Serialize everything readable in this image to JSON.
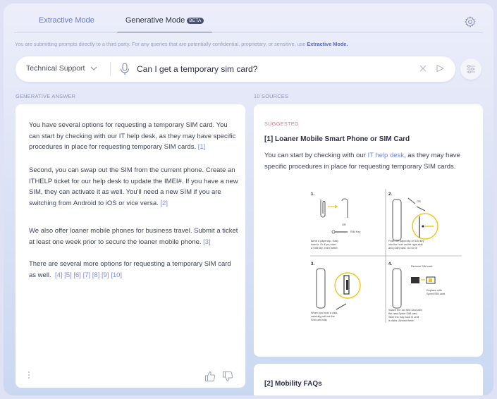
{
  "tabs": [
    {
      "label": "Extractive Mode"
    },
    {
      "label": "Generative Mode",
      "badge": "BETA"
    }
  ],
  "notice": {
    "text": "You are submitting prompts directly to a third party. For any queries that are potentially confidential, proprietary, or sensitive, use ",
    "link": "Extractive Mode."
  },
  "search": {
    "category": "Technical Support",
    "query": "Can I get a temporary sim card?"
  },
  "answer": {
    "label": "GENERATIVE ANSWER",
    "paragraphs": [
      {
        "text": "You have several options for requesting a temporary SIM card. You can start by checking with our IT help desk, as they may have specific procedures in place for requesting temporary SIM cards.",
        "cites": [
          "[1]"
        ]
      },
      {
        "text": "Second, you can swap out the SIM from the current phone. Create an ITHELP ticket for our help desk to update the IMEI#. If you have a new SIM, they can activate it as well. You'll need a new SIM if you are switching from Android to iOS or vice versa.",
        "cites": [
          "[2]"
        ]
      },
      {
        "text": "We also offer loaner mobile phones for business travel. Submit a ticket at least one week prior to secure the loaner mobile phone.",
        "cites": [
          "[3]"
        ]
      },
      {
        "text": "There are several more options for requesting a temporary SIM card as well.",
        "cites": [
          "[4]",
          "[5]",
          "[6]",
          "[7]",
          "[8]",
          "[9]",
          "[10]"
        ]
      }
    ]
  },
  "sources": {
    "label": "10 SOURCES",
    "items": [
      {
        "tag": "SUGGESTED",
        "title": "[1] Loaner Mobile Smart Phone or SIM Card",
        "text_before": "You can start by checking with our ",
        "link": "IT help desk",
        "text_after": ", as they may have specific procedures in place for requesting temporary SIM cards.",
        "diagram": {
          "steps": [
            {
              "num": "1.",
              "caption": [
                "Bend a paperclip. Easy",
                "does it. Or if you own",
                "a SIM key, even better."
              ],
              "labels": [
                "OR",
                "SIM Key"
              ]
            },
            {
              "num": "2.",
              "caption": [
                "Poke the paperclip or SIM key",
                "into the hole on the right side",
                "and push hard. Go for it!"
              ],
              "labels": [
                "OR"
              ]
            },
            {
              "num": "3.",
              "caption": [
                "When you hear a click,",
                "carefully pull out the",
                "SIM card tray."
              ],
              "labels": []
            },
            {
              "num": "4.",
              "caption": [
                "Switch the old SIM card with",
                "the new Sprint SIM card.",
                "Slide the tray back in until",
                "it clicks. Almost there!"
              ],
              "labels": [
                "Remove SIM card",
                "Replace with",
                "Sprint SIM card"
              ]
            }
          ]
        }
      },
      {
        "title": "[2] Mobility FAQs"
      }
    ]
  },
  "colors": {
    "accent": "#6d7fd8",
    "link": "#7b8be0",
    "suggested": "#e0748a",
    "diagram_highlight": "#f0c419"
  }
}
